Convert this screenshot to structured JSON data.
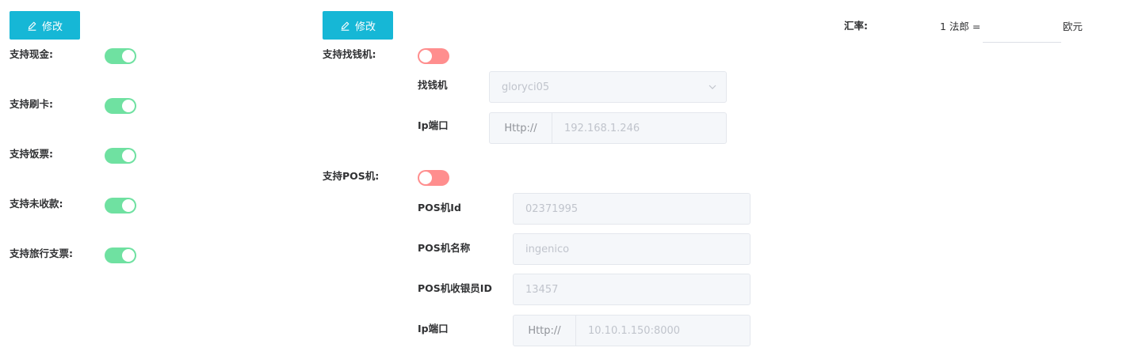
{
  "left": {
    "edit_label": "修改",
    "items": [
      {
        "label": "支持现金:",
        "on": true
      },
      {
        "label": "支持刷卡:",
        "on": true
      },
      {
        "label": "支持饭票:",
        "on": true
      },
      {
        "label": "支持未收款:",
        "on": true
      },
      {
        "label": "支持旅行支票:",
        "on": true
      }
    ]
  },
  "middle": {
    "edit_label": "修改",
    "cash_machine": {
      "label": "支持找钱机:",
      "on": false,
      "machine_label": "找钱机",
      "machine_value": "gloryci05",
      "ip_label": "Ip端口",
      "ip_prefix": "Http://",
      "ip_value": "192.168.1.246"
    },
    "pos": {
      "label": "支持POS机:",
      "on": false,
      "id_label": "POS机Id",
      "id_value": "02371995",
      "name_label": "POS机名称",
      "name_value": "ingenico",
      "cashier_label": "POS机收银员ID",
      "cashier_value": "13457",
      "ip_label": "Ip端口",
      "ip_prefix": "Http://",
      "ip_value": "10.10.1.150:8000"
    }
  },
  "rate": {
    "label": "汇率:",
    "prefix": "1 法郎 =",
    "value": "",
    "suffix": "欧元"
  },
  "colors": {
    "accent": "#16b7d6",
    "switch_on": "#6fe1a1",
    "switch_off": "#ff8e8e"
  },
  "icons": {
    "edit": "pencil-icon",
    "dropdown": "chevron-down-icon"
  }
}
